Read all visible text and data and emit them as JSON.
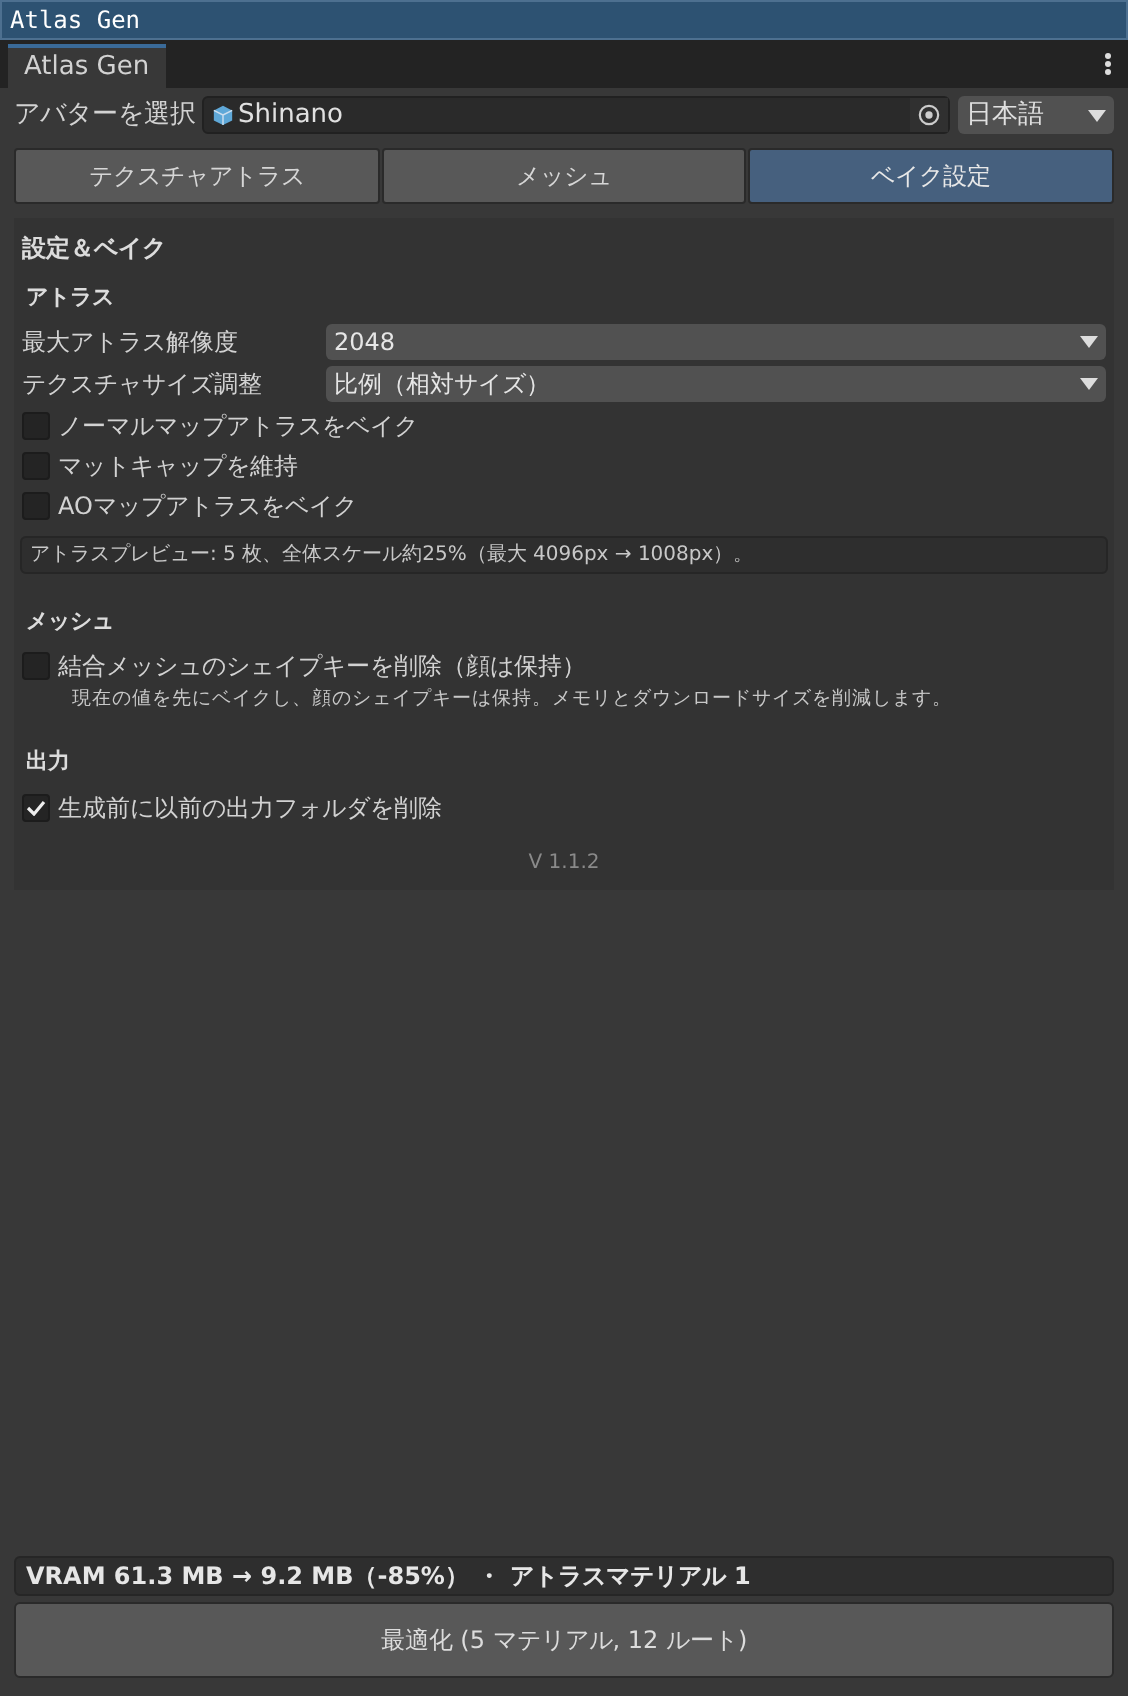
{
  "window": {
    "title": "Atlas Gen"
  },
  "panel_tab": {
    "label": "Atlas Gen"
  },
  "avatar": {
    "label": "アバターを選択",
    "value": "Shinano"
  },
  "language": {
    "value": "日本語"
  },
  "tabs": [
    {
      "label": "テクスチャアトラス",
      "selected": false
    },
    {
      "label": "メッシュ",
      "selected": false
    },
    {
      "label": "ベイク設定",
      "selected": true
    }
  ],
  "section_title": "設定＆ベイク",
  "groups": [
    {
      "title": "アトラス",
      "items": [
        {
          "kind": "dropdown",
          "label": "最大アトラス解像度",
          "value": "2048"
        },
        {
          "kind": "dropdown",
          "label": "テクスチャサイズ調整",
          "value": "比例（相対サイズ）"
        },
        {
          "kind": "checkbox",
          "label": "ノーマルマップアトラスをベイク",
          "checked": false
        },
        {
          "kind": "checkbox",
          "label": "マットキャップを維持",
          "checked": false
        },
        {
          "kind": "checkbox",
          "label": "AOマップアトラスをベイク",
          "checked": false
        },
        {
          "kind": "info",
          "text": "アトラスプレビュー: 5 枚、全体スケール約25%（最大 4096px → 1008px）。"
        }
      ]
    },
    {
      "title": "メッシュ",
      "items": [
        {
          "kind": "checkbox",
          "label": "結合メッシュのシェイプキーを削除（顔は保持）",
          "checked": false
        },
        {
          "kind": "note",
          "text": "現在の値を先にベイクし、顔のシェイプキーは保持。メモリとダウンロードサイズを削減します。"
        }
      ]
    },
    {
      "title": "出力",
      "items": [
        {
          "kind": "checkbox",
          "label": "生成前に以前の出力フォルダを削除",
          "checked": true
        }
      ]
    }
  ],
  "version": "V 1.1.2",
  "summary": "VRAM 61.3 MB → 9.2 MB（-85%） ・ アトラスマテリアル 1",
  "optimize_button": "最適化 (5 マテリアル, 12 ルート)"
}
